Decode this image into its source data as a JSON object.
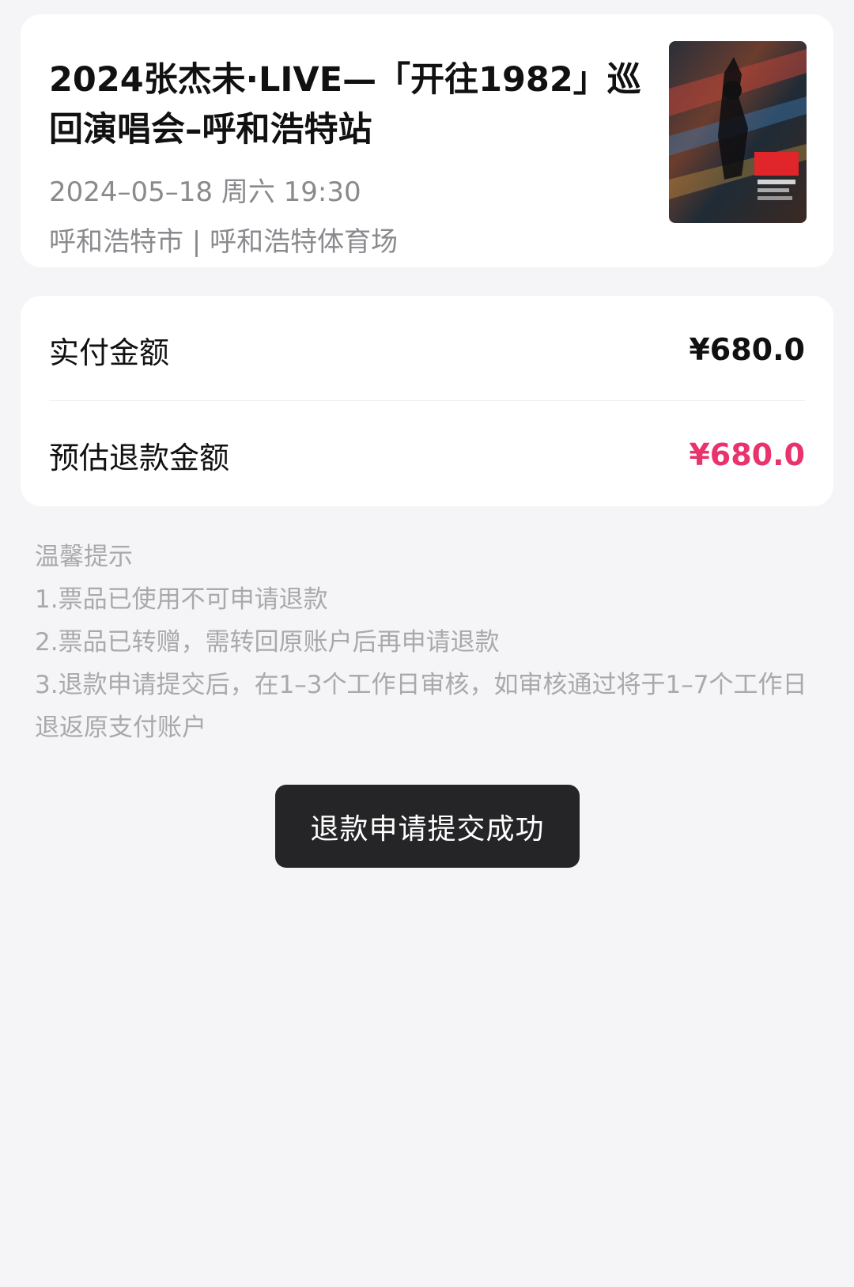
{
  "event": {
    "title": "2024张杰未·LIVE—「开往1982」巡回演唱会–呼和浩特站",
    "datetime": "2024–05–18 周六 19:30",
    "venue": "呼和浩特市 | 呼和浩特体育场",
    "poster_icon": "concert-poster-image"
  },
  "amounts": {
    "paid_label": "实付金额",
    "paid_value": "¥680.0",
    "refund_label": "预估退款金额",
    "refund_value": "¥680.0",
    "refund_color": "#e8336d"
  },
  "tips": {
    "heading": "温馨提示",
    "items": [
      "1.票品已使用不可申请退款",
      "2.票品已转赠，需转回原账户后再申请退款",
      "3.退款申请提交后，在1–3个工作日审核，如审核通过将于1–7个工作日退返原支付账户"
    ]
  },
  "toast": {
    "message": "退款申请提交成功"
  }
}
